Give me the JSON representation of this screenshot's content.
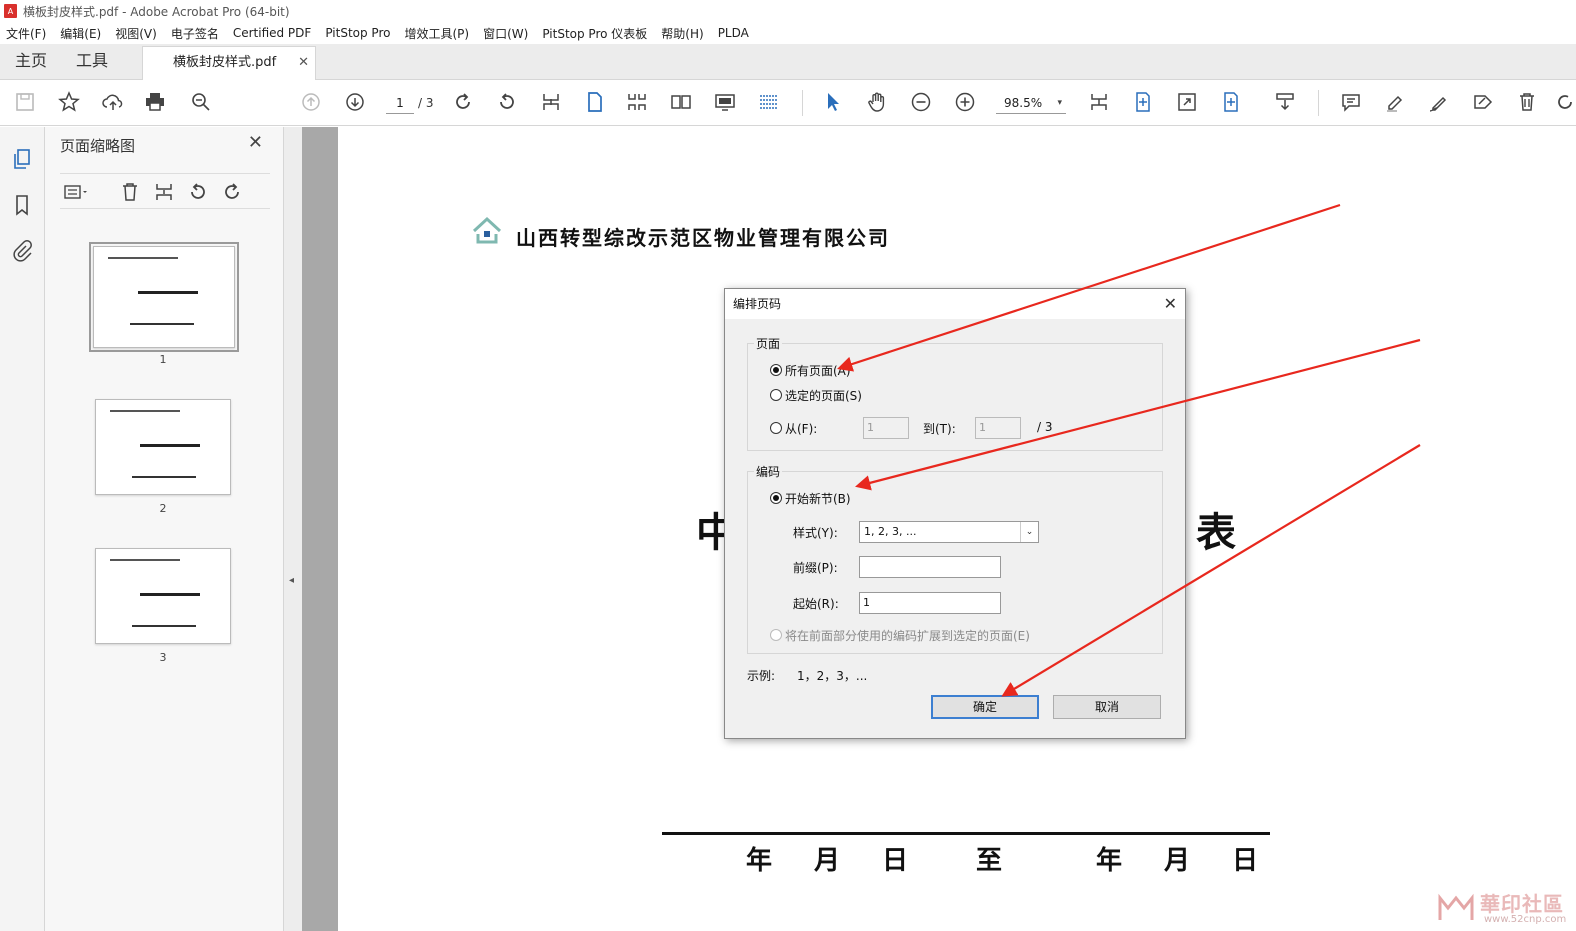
{
  "window": {
    "title": "横板封皮样式.pdf - Adobe Acrobat Pro (64-bit)"
  },
  "menu": [
    "文件(F)",
    "编辑(E)",
    "视图(V)",
    "电子签名",
    "Certified PDF",
    "PitStop Pro",
    "增效工具(P)",
    "窗口(W)",
    "PitStop Pro 仪表板",
    "帮助(H)",
    "PLDA"
  ],
  "tabs": {
    "home": "主页",
    "tools": "工具",
    "doc": "横板封皮样式.pdf",
    "close": "✕"
  },
  "toolbar": {
    "page_current": "1",
    "page_total": "/ 3",
    "zoom": "98.5%",
    "zoom_arrow": "▾"
  },
  "thumbnails": {
    "title": "页面缩略图",
    "close": "✕",
    "pages": [
      "1",
      "2",
      "3"
    ]
  },
  "collapse_arrow": "◂",
  "document": {
    "company": "山西转型综改示范区物业管理有限公司",
    "title_left": "中",
    "title_right": "表",
    "date_parts": [
      "年",
      "月",
      "日",
      "至",
      "年",
      "月",
      "日"
    ]
  },
  "dialog": {
    "title": "编排页码",
    "close": "✕",
    "pages_group": "页面",
    "all_pages": "所有页面(A)",
    "selected_pages": "选定的页面(S)",
    "from": "从(F):",
    "from_value": "1",
    "to": "到(T):",
    "to_value": "1",
    "of_total": "/ 3",
    "numbering_group": "编码",
    "new_section": "开始新节(B)",
    "style_label": "样式(Y):",
    "style_value": "1, 2, 3, ...",
    "style_arrow": "⌄",
    "prefix_label": "前缀(P):",
    "prefix_value": "",
    "start_label": "起始(R):",
    "start_value": "1",
    "extend": "将在前面部分使用的编码扩展到选定的页面(E)",
    "example_label": "示例:",
    "example_value": "1，2，3，...",
    "ok": "确定",
    "cancel": "取消"
  },
  "watermark": {
    "text": "華印社區",
    "sub": "www.52cnp.com"
  },
  "colors": {
    "arrow": "#e8281e",
    "accent": "#2a6ebb",
    "ok_border": "#3c7fd1"
  }
}
